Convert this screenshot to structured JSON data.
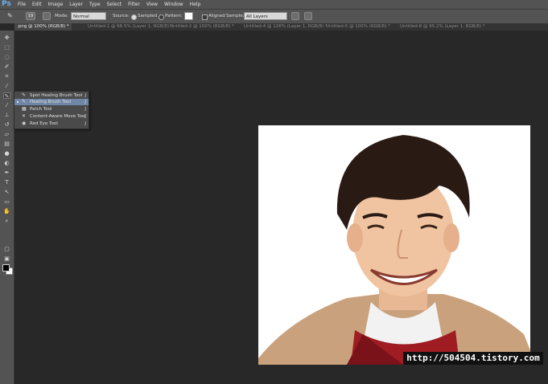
{
  "app": {
    "logo": "Ps"
  },
  "menu": [
    "File",
    "Edit",
    "Image",
    "Layer",
    "Type",
    "Select",
    "Filter",
    "View",
    "Window",
    "Help"
  ],
  "options": {
    "brush_size": "19",
    "mode_label": "Mode:",
    "mode_value": "Normal",
    "source_label": "Source:",
    "sampled_label": "Sampled",
    "pattern_label": "Pattern:",
    "aligned_label": "Aligned",
    "sample_label": "Sample:",
    "sample_value": "All Layers"
  },
  "tabs": [
    {
      "label": ".png @ 100% (RGB/8) *",
      "active": true
    },
    {
      "label": "Untitled-1 @ 66.5% (Layer 1, RGB/8) *",
      "active": false
    },
    {
      "label": "Untitled-2 @ 100% (RGB/8) *",
      "active": false
    },
    {
      "label": "Untitled-4 @ 126% (Layer 1, RGB/8) *",
      "active": false
    },
    {
      "label": "Untitled-5 @ 100% (RGB/8) *",
      "active": false
    },
    {
      "label": "Untitled-6 @ 95.2% (Layer 1, RGB/8) *",
      "active": false
    }
  ],
  "flyout": [
    {
      "label": "Spot Healing Brush Tool",
      "key": "J",
      "icon": "spot-healing-icon",
      "selected": false
    },
    {
      "label": "Healing Brush Tool",
      "key": "J",
      "icon": "healing-brush-icon",
      "selected": true
    },
    {
      "label": "Patch Tool",
      "key": "J",
      "icon": "patch-icon",
      "selected": false
    },
    {
      "label": "Content-Aware Move Tool",
      "key": "J",
      "icon": "content-aware-move-icon",
      "selected": false
    },
    {
      "label": "Red Eye Tool",
      "key": "J",
      "icon": "red-eye-icon",
      "selected": false
    }
  ],
  "tools": [
    "move",
    "marquee",
    "lasso",
    "quick-select",
    "crop",
    "eyedropper",
    "healing-brush",
    "brush",
    "clone-stamp",
    "history-brush",
    "eraser",
    "gradient",
    "blur",
    "dodge",
    "pen",
    "type",
    "path-select",
    "shape",
    "hand",
    "zoom"
  ],
  "watermark": "http://504504.tistory.com",
  "colors": {
    "foreground": "#000000",
    "background": "#ffffff",
    "flyout_highlight": "#6f86a6"
  }
}
